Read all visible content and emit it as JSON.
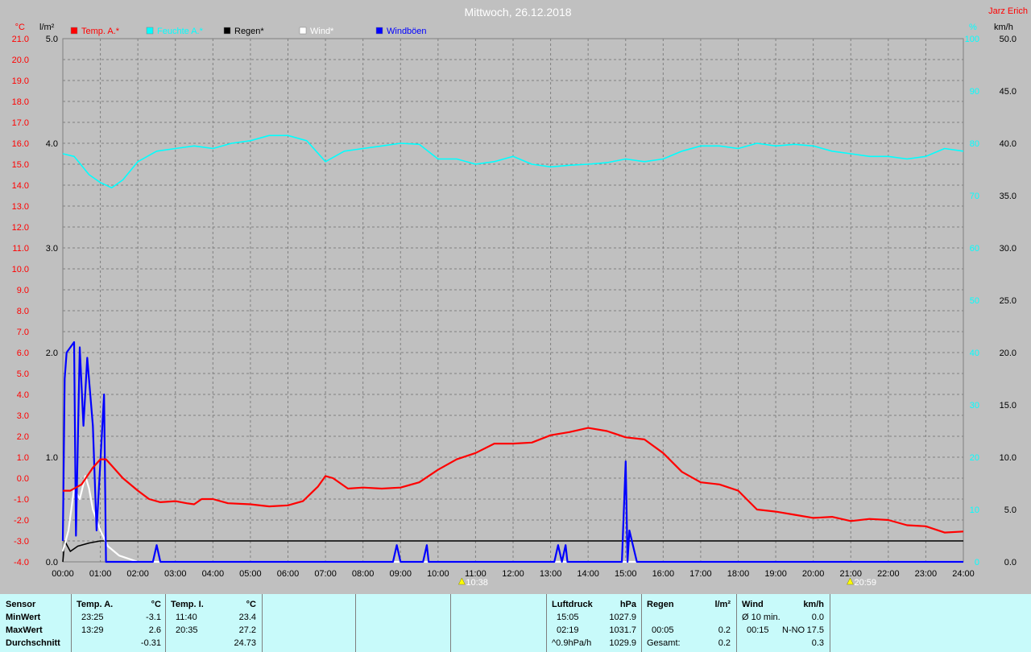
{
  "header": {
    "title": "Mittwoch, 26.12.2018",
    "author": "Jarz Erich"
  },
  "legend": [
    {
      "label": "Temp. A.*",
      "color": "#ff0000"
    },
    {
      "label": "Feuchte A.*",
      "color": "#00ffff"
    },
    {
      "label": "Regen*",
      "color": "#000000"
    },
    {
      "label": "Wind*",
      "color": "#ffffff"
    },
    {
      "label": "Windböen",
      "color": "#0000ff"
    }
  ],
  "axes": {
    "temp_unit": "°C",
    "rain_unit": "l/m²",
    "hum_unit": "%",
    "wind_unit": "km/h",
    "temp_ticks": [
      "21.0",
      "20.0",
      "19.0",
      "18.0",
      "17.0",
      "16.0",
      "15.0",
      "14.0",
      "13.0",
      "12.0",
      "11.0",
      "10.0",
      "9.0",
      "8.0",
      "7.0",
      "6.0",
      "5.0",
      "4.0",
      "3.0",
      "2.0",
      "1.0",
      "0.0",
      "-1.0",
      "-2.0",
      "-3.0",
      "-4.0"
    ],
    "rain_ticks": [
      "5.0",
      "4.0",
      "3.0",
      "2.0",
      "1.0",
      "0.0"
    ],
    "hum_ticks": [
      "100",
      "90",
      "80",
      "70",
      "60",
      "50",
      "40",
      "30",
      "20",
      "10",
      "0"
    ],
    "wind_ticks": [
      "50.0",
      "45.0",
      "40.0",
      "35.0",
      "30.0",
      "25.0",
      "20.0",
      "15.0",
      "10.0",
      "5.0",
      "0.0"
    ],
    "time_ticks": [
      "00:00",
      "01:00",
      "02:00",
      "03:00",
      "04:00",
      "05:00",
      "06:00",
      "07:00",
      "08:00",
      "09:00",
      "10:00",
      "11:00",
      "12:00",
      "13:00",
      "14:00",
      "15:00",
      "16:00",
      "17:00",
      "18:00",
      "19:00",
      "20:00",
      "21:00",
      "22:00",
      "23:00",
      "24:00"
    ]
  },
  "markers": {
    "sunrise": "10:38",
    "sunset": "20:59"
  },
  "chart_data": {
    "type": "line",
    "title": "Mittwoch, 26.12.2018",
    "x_unit": "hour",
    "axis_ranges": {
      "temp": [
        -4,
        21
      ],
      "rain": [
        0,
        5
      ],
      "humidity": [
        0,
        100
      ],
      "wind": [
        0,
        50
      ]
    },
    "grid": true,
    "legend_position": "top-left",
    "series": [
      {
        "name": "Temp. A.*",
        "axis": "temp",
        "color": "#ff0000",
        "points": [
          [
            0,
            -0.6
          ],
          [
            0.2,
            -0.6
          ],
          [
            0.5,
            -0.3
          ],
          [
            0.8,
            0.5
          ],
          [
            1,
            0.9
          ],
          [
            1.15,
            0.9
          ],
          [
            1.3,
            0.6
          ],
          [
            1.6,
            0
          ],
          [
            2,
            -0.6
          ],
          [
            2.3,
            -1
          ],
          [
            2.6,
            -1.15
          ],
          [
            3,
            -1.1
          ],
          [
            3.3,
            -1.2
          ],
          [
            3.5,
            -1.25
          ],
          [
            3.7,
            -1
          ],
          [
            4,
            -1
          ],
          [
            4.4,
            -1.2
          ],
          [
            5,
            -1.25
          ],
          [
            5.5,
            -1.35
          ],
          [
            6,
            -1.3
          ],
          [
            6.4,
            -1.1
          ],
          [
            6.8,
            -0.4
          ],
          [
            7,
            0.1
          ],
          [
            7.2,
            0
          ],
          [
            7.6,
            -0.5
          ],
          [
            8,
            -0.45
          ],
          [
            8.5,
            -0.5
          ],
          [
            9,
            -0.45
          ],
          [
            9.5,
            -0.2
          ],
          [
            10,
            0.4
          ],
          [
            10.5,
            0.9
          ],
          [
            11,
            1.2
          ],
          [
            11.5,
            1.65
          ],
          [
            12,
            1.65
          ],
          [
            12.5,
            1.7
          ],
          [
            13,
            2.05
          ],
          [
            13.5,
            2.2
          ],
          [
            14,
            2.4
          ],
          [
            14.5,
            2.25
          ],
          [
            15,
            1.95
          ],
          [
            15.5,
            1.85
          ],
          [
            16,
            1.2
          ],
          [
            16.5,
            0.3
          ],
          [
            17,
            -0.2
          ],
          [
            17.5,
            -0.3
          ],
          [
            18,
            -0.6
          ],
          [
            18.5,
            -1.5
          ],
          [
            19,
            -1.6
          ],
          [
            19.5,
            -1.75
          ],
          [
            20,
            -1.9
          ],
          [
            20.5,
            -1.85
          ],
          [
            21,
            -2.05
          ],
          [
            21.5,
            -1.95
          ],
          [
            22,
            -2
          ],
          [
            22.5,
            -2.25
          ],
          [
            23,
            -2.3
          ],
          [
            23.5,
            -2.6
          ],
          [
            24,
            -2.55
          ]
        ]
      },
      {
        "name": "Feuchte A.*",
        "axis": "humidity",
        "color": "#00ffff",
        "points": [
          [
            0,
            78
          ],
          [
            0.3,
            77.5
          ],
          [
            0.7,
            74
          ],
          [
            1,
            72.5
          ],
          [
            1.3,
            71.5
          ],
          [
            1.6,
            73
          ],
          [
            2,
            76.5
          ],
          [
            2.5,
            78.5
          ],
          [
            3,
            79
          ],
          [
            3.5,
            79.5
          ],
          [
            4,
            79
          ],
          [
            4.5,
            80
          ],
          [
            5,
            80.5
          ],
          [
            5.5,
            81.5
          ],
          [
            6,
            81.5
          ],
          [
            6.5,
            80.5
          ],
          [
            7,
            76.5
          ],
          [
            7.5,
            78.5
          ],
          [
            8,
            79
          ],
          [
            8.5,
            79.5
          ],
          [
            9,
            80
          ],
          [
            9.5,
            79.8
          ],
          [
            10,
            77
          ],
          [
            10.5,
            77
          ],
          [
            11,
            76
          ],
          [
            11.5,
            76.5
          ],
          [
            12,
            77.5
          ],
          [
            12.5,
            76
          ],
          [
            13,
            75.5
          ],
          [
            13.5,
            75.8
          ],
          [
            14,
            76
          ],
          [
            14.5,
            76.3
          ],
          [
            15,
            77
          ],
          [
            15.5,
            76.5
          ],
          [
            16,
            77
          ],
          [
            16.5,
            78.5
          ],
          [
            17,
            79.5
          ],
          [
            17.5,
            79.5
          ],
          [
            18,
            79
          ],
          [
            18.5,
            80
          ],
          [
            19,
            79.5
          ],
          [
            19.5,
            79.8
          ],
          [
            20,
            79.5
          ],
          [
            20.5,
            78.5
          ],
          [
            21,
            78
          ],
          [
            21.5,
            77.5
          ],
          [
            22,
            77.5
          ],
          [
            22.5,
            77
          ],
          [
            23,
            77.5
          ],
          [
            23.5,
            79
          ],
          [
            24,
            78.5
          ]
        ]
      },
      {
        "name": "Regen*",
        "axis": "rain",
        "color": "#000000",
        "points": [
          [
            0,
            0
          ],
          [
            0.05,
            0.2
          ],
          [
            0.2,
            0.1
          ],
          [
            0.4,
            0.15
          ],
          [
            0.7,
            0.18
          ],
          [
            1,
            0.2
          ],
          [
            1.2,
            0.2
          ],
          [
            24,
            0.2
          ]
        ]
      },
      {
        "name": "Wind*",
        "axis": "wind",
        "color": "#ffffff",
        "points": [
          [
            0,
            1
          ],
          [
            0.15,
            3
          ],
          [
            0.3,
            7
          ],
          [
            0.45,
            6
          ],
          [
            0.6,
            8.2
          ],
          [
            0.7,
            7
          ],
          [
            0.8,
            5
          ],
          [
            1,
            3
          ],
          [
            1.2,
            1.5
          ],
          [
            1.5,
            0.6
          ],
          [
            2,
            0
          ],
          [
            24,
            0
          ]
        ]
      },
      {
        "name": "Windböen",
        "axis": "wind",
        "color": "#0000ff",
        "points": [
          [
            0,
            2
          ],
          [
            0.05,
            17.5
          ],
          [
            0.1,
            20
          ],
          [
            0.3,
            21
          ],
          [
            0.35,
            2.5
          ],
          [
            0.45,
            20.5
          ],
          [
            0.55,
            13
          ],
          [
            0.65,
            19.5
          ],
          [
            0.8,
            13
          ],
          [
            0.9,
            3
          ],
          [
            1.1,
            16
          ],
          [
            1.15,
            0
          ],
          [
            2.4,
            0
          ],
          [
            2.5,
            1.6
          ],
          [
            2.6,
            0
          ],
          [
            8.8,
            0
          ],
          [
            8.9,
            1.6
          ],
          [
            9,
            0
          ],
          [
            9.6,
            0
          ],
          [
            9.7,
            1.6
          ],
          [
            9.75,
            0
          ],
          [
            13.1,
            0
          ],
          [
            13.2,
            1.6
          ],
          [
            13.3,
            0
          ],
          [
            13.4,
            1.6
          ],
          [
            13.45,
            0
          ],
          [
            14.9,
            0
          ],
          [
            15,
            9.6
          ],
          [
            15.05,
            0
          ],
          [
            15.1,
            3
          ],
          [
            15.3,
            0
          ],
          [
            24,
            0
          ]
        ]
      }
    ]
  },
  "stats": {
    "sensor": {
      "header": "Sensor",
      "rows": [
        "MinWert",
        "MaxWert",
        "Durchschnitt"
      ]
    },
    "temp_a": {
      "header": "Temp. A.",
      "unit": "°C",
      "min_time": "23:25",
      "min": "-3.1",
      "max_time": "13:29",
      "max": "2.6",
      "avg": "-0.31"
    },
    "temp_i": {
      "header": "Temp. I.",
      "unit": "°C",
      "min_time": "11:40",
      "min": "23.4",
      "max_time": "20:35",
      "max": "27.2",
      "avg": "24.73"
    },
    "pressure": {
      "header": "Luftdruck",
      "unit": "hPa",
      "min_time": "15:05",
      "min": "1027.9",
      "max_time": "02:19",
      "max": "1031.7",
      "trend": "^0.9hPa/h",
      "avg": "1029.9"
    },
    "rain": {
      "header": "Regen",
      "unit": "l/m²",
      "max_time": "00:05",
      "max": "0.2",
      "total_label": "Gesamt:",
      "total": "0.2"
    },
    "wind": {
      "header": "Wind",
      "unit": "km/h",
      "min_label": "Ø 10 min.",
      "min": "0.0",
      "max_time": "00:15",
      "max_dir": "N-NO",
      "max": "17.5",
      "avg": "0.3"
    }
  }
}
